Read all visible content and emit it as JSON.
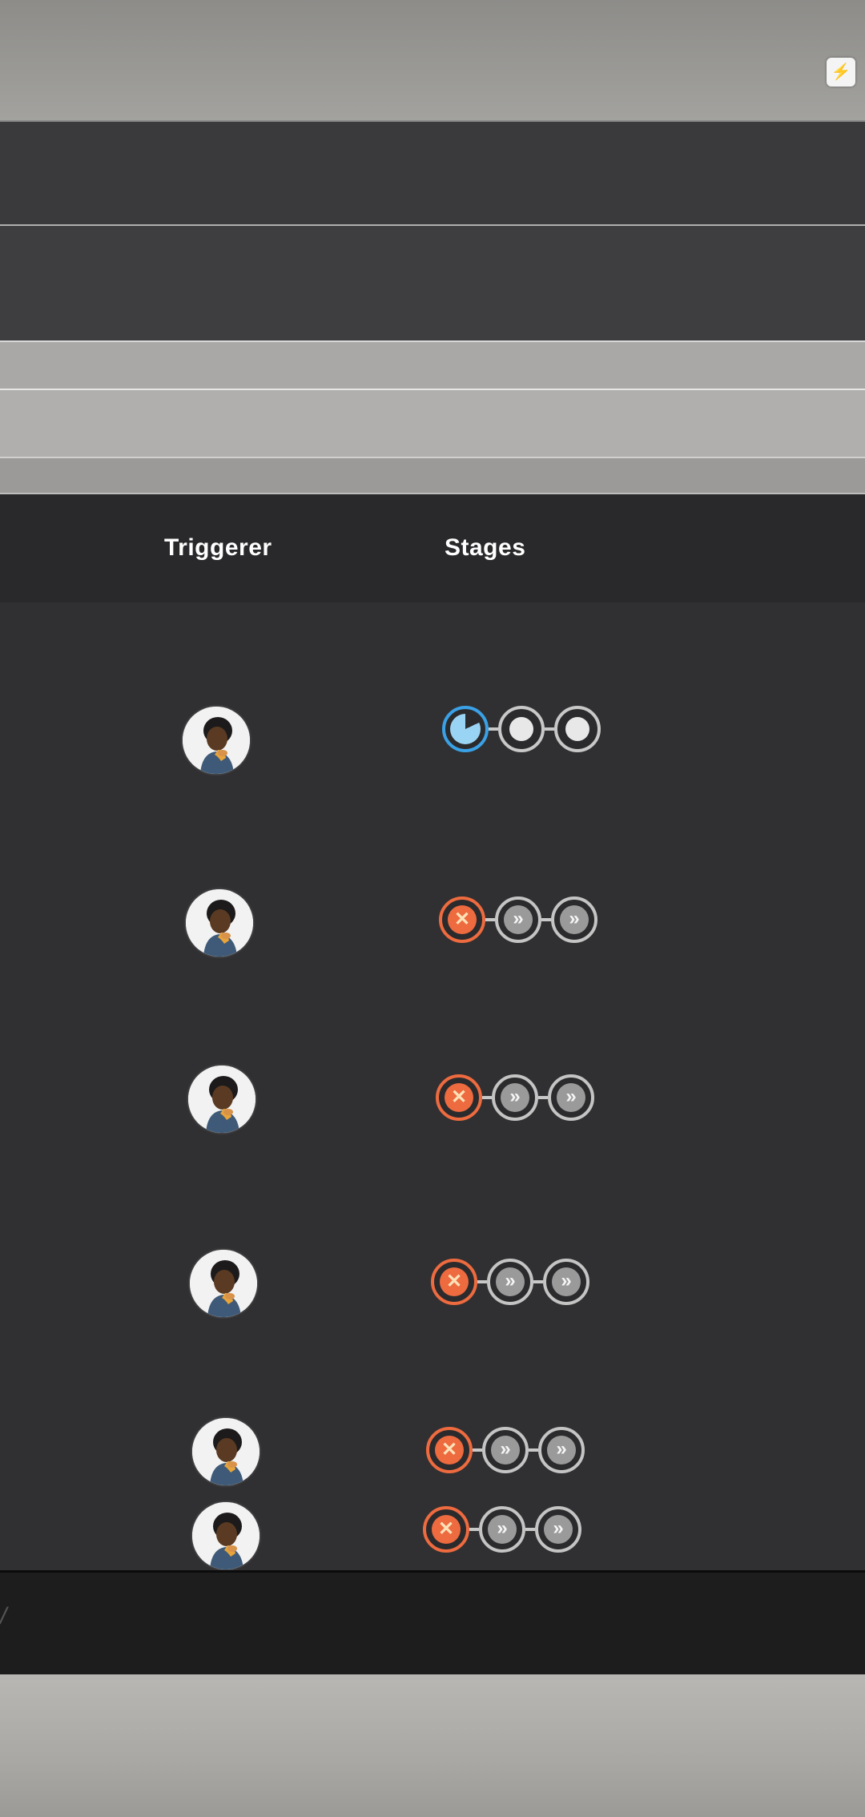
{
  "top_action": {
    "icon": "lightning-icon",
    "glyph": "⚡"
  },
  "table": {
    "columns": {
      "triggerer": "Triggerer",
      "stages": "Stages"
    },
    "rows": [
      {
        "triggerer_icon": "avatar",
        "stages": [
          "running",
          "pending",
          "pending"
        ]
      },
      {
        "triggerer_icon": "avatar",
        "stages": [
          "failed",
          "skipped",
          "skipped"
        ]
      },
      {
        "triggerer_icon": "avatar",
        "stages": [
          "failed",
          "skipped",
          "skipped"
        ]
      },
      {
        "triggerer_icon": "avatar",
        "stages": [
          "failed",
          "skipped",
          "skipped"
        ]
      },
      {
        "triggerer_icon": "avatar",
        "stages": [
          "failed",
          "skipped",
          "skipped"
        ]
      },
      {
        "triggerer_icon": "avatar",
        "stages": [
          "failed",
          "skipped",
          "skipped"
        ]
      }
    ]
  },
  "stage_glyphs": {
    "failed": "✕",
    "skipped": "»"
  },
  "colors": {
    "running": "#3aa1e6",
    "failed": "#ee6a3f",
    "pending": "#c8c8c8",
    "skipped": "#9a9a9a"
  }
}
